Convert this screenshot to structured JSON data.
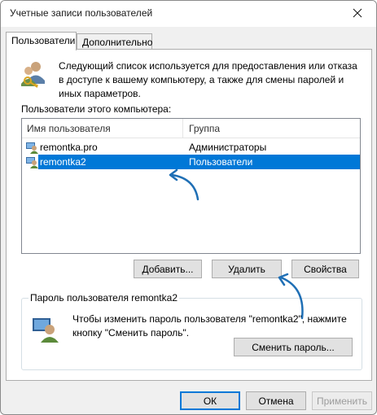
{
  "window": {
    "title": "Учетные записи пользователей",
    "close_icon": "close-icon"
  },
  "tabs": [
    {
      "label": "Пользователи",
      "active": true
    },
    {
      "label": "Дополнительно",
      "active": false
    }
  ],
  "intro": {
    "icon": "users-keys-icon",
    "text": "Следующий список используется для предоставления или отказа в доступе к вашему компьютеру, а также для смены паролей и иных параметров."
  },
  "users_list": {
    "label": "Пользователи этого компьютера:",
    "columns": [
      "Имя пользователя",
      "Группа"
    ],
    "rows": [
      {
        "name": "remontka.pro",
        "group": "Администраторы",
        "selected": false
      },
      {
        "name": "remontka2",
        "group": "Пользователи",
        "selected": true
      }
    ]
  },
  "list_buttons": {
    "add": "Добавить...",
    "remove": "Удалить",
    "properties": "Свойства"
  },
  "password_group": {
    "title": "Пароль пользователя remontka2",
    "icon": "user-password-icon",
    "text": "Чтобы изменить пароль пользователя \"remontka2\", нажмите кнопку \"Сменить пароль\".",
    "change_button": "Сменить пароль..."
  },
  "dialog_buttons": {
    "ok": "ОК",
    "cancel": "Отмена",
    "apply": "Применить",
    "apply_disabled": true
  },
  "colors": {
    "selection": "#0078d7",
    "annotation_arrow": "#1f6fb5"
  }
}
